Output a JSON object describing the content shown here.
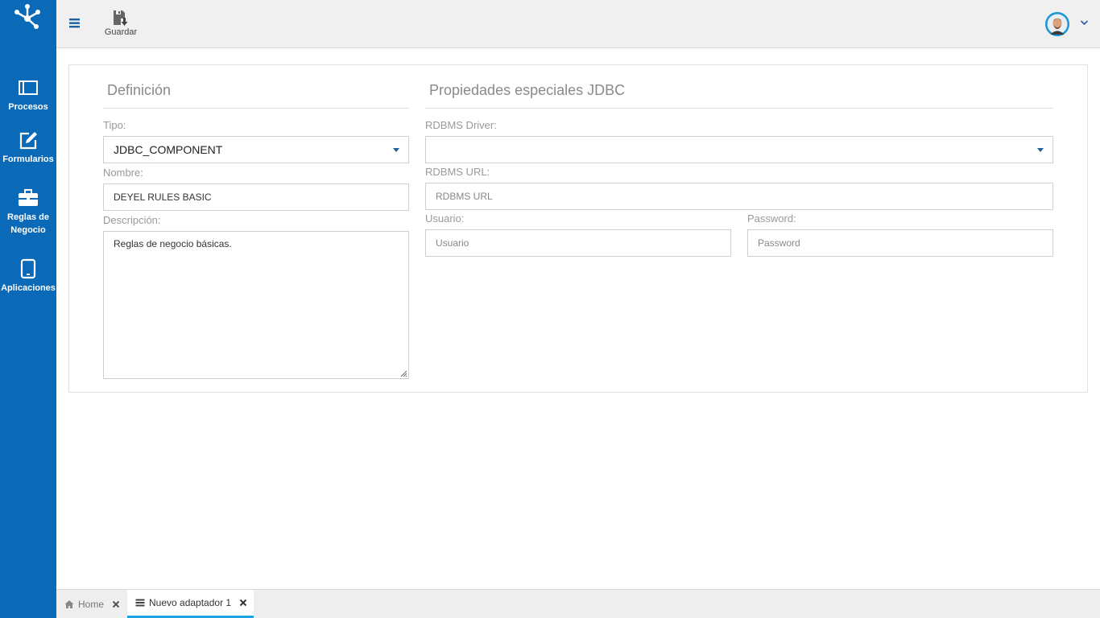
{
  "sidebar": {
    "logo_icon": "deyel-logo-icon",
    "items": [
      {
        "label": "Procesos",
        "icon": "window-icon"
      },
      {
        "label": "Formularios",
        "icon": "edit-icon"
      },
      {
        "label_line1": "Reglas de",
        "label_line2": "Negocio",
        "icon": "briefcase-icon"
      },
      {
        "label": "Aplicaciones",
        "icon": "tablet-icon"
      }
    ]
  },
  "toolbar": {
    "menu_icon": "hamburger-icon",
    "save_label": "Guardar",
    "save_icon": "floppy-download-icon",
    "user_icon": "avatar",
    "user_menu_icon": "chevron-down-icon"
  },
  "definicion": {
    "title": "Definición",
    "tipo_label": "Tipo:",
    "tipo_value": "JDBC_COMPONENT",
    "nombre_label": "Nombre:",
    "nombre_value": "DEYEL RULES BASIC",
    "descripcion_label": "Descripción:",
    "descripcion_value": "Reglas de negocio básicas."
  },
  "jdbc": {
    "title": "Propiedades especiales JDBC",
    "driver_label": "RDBMS Driver:",
    "driver_value": "",
    "url_label": "RDBMS URL:",
    "url_placeholder": "RDBMS URL",
    "usuario_label": "Usuario:",
    "usuario_placeholder": "Usuario",
    "password_label": "Password:",
    "password_placeholder": "Password"
  },
  "tabs": [
    {
      "label": "Home",
      "icon": "home-icon",
      "active": false
    },
    {
      "label": "Nuevo adaptador 1",
      "icon": "list-icon",
      "active": true
    }
  ],
  "colors": {
    "sidebar": "#0b6ab8",
    "accent": "#1aa3e0",
    "caret": "#1f5f9e"
  }
}
